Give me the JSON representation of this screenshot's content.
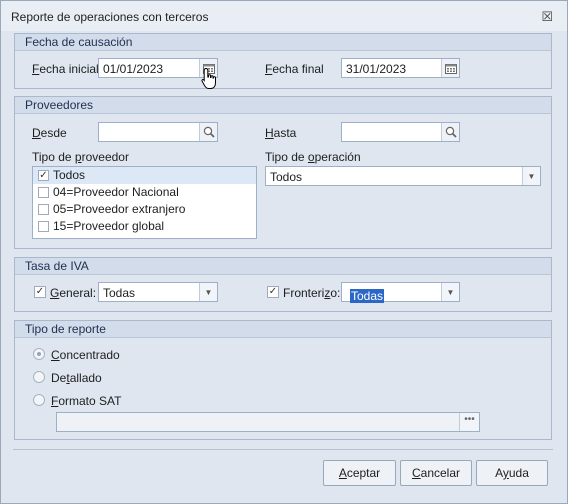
{
  "window": {
    "title": "Reporte de operaciones con terceros",
    "close_glyph": "☒"
  },
  "fecha": {
    "header": "Fecha de causación",
    "inicial_label_u": "F",
    "inicial_label_rest": "echa inicial",
    "inicial_value": "01/01/2023",
    "final_label_u": "F",
    "final_label_rest": "echa final",
    "final_value": "31/01/2023"
  },
  "proveedores": {
    "header": "Proveedores",
    "desde_u": "D",
    "desde_rest": "esde",
    "desde_value": "",
    "hasta_u": "H",
    "hasta_rest": "asta",
    "hasta_value": "",
    "tipo_proveedor_pre": "Tipo de ",
    "tipo_proveedor_u": "p",
    "tipo_proveedor_post": "roveedor",
    "tipo_operacion_pre": "Tipo de ",
    "tipo_operacion_u": "o",
    "tipo_operacion_post": "peración",
    "tipo_operacion_value": "Todos",
    "items": [
      {
        "label": "Todos",
        "checked": "✓"
      },
      {
        "label": "04=Proveedor Nacional",
        "checked": ""
      },
      {
        "label": "05=Proveedor extranjero",
        "checked": ""
      },
      {
        "label": "15=Proveedor global",
        "checked": ""
      }
    ]
  },
  "iva": {
    "header": "Tasa de IVA",
    "general_u": "G",
    "general_rest": "eneral:",
    "general_check": "✓",
    "general_value": "Todas",
    "fronterizo_pre": "Fronteri",
    "fronterizo_u": "z",
    "fronterizo_post": "o:",
    "fronterizo_check": "✓",
    "fronterizo_value": "Todas"
  },
  "reporte": {
    "header": "Tipo de reporte",
    "concentrado_u": "C",
    "concentrado_rest": "oncentrado",
    "detallado_pre": "De",
    "detallado_u": "t",
    "detallado_post": "allado",
    "formato_u": "F",
    "formato_rest": "ormato SAT",
    "path_value": "",
    "dots": "•••"
  },
  "buttons": {
    "aceptar_u": "A",
    "aceptar_rest": "ceptar",
    "cancelar_u": "C",
    "cancelar_rest": "ancelar",
    "ayuda_pre": "A",
    "ayuda_u": "y",
    "ayuda_post": "uda"
  }
}
